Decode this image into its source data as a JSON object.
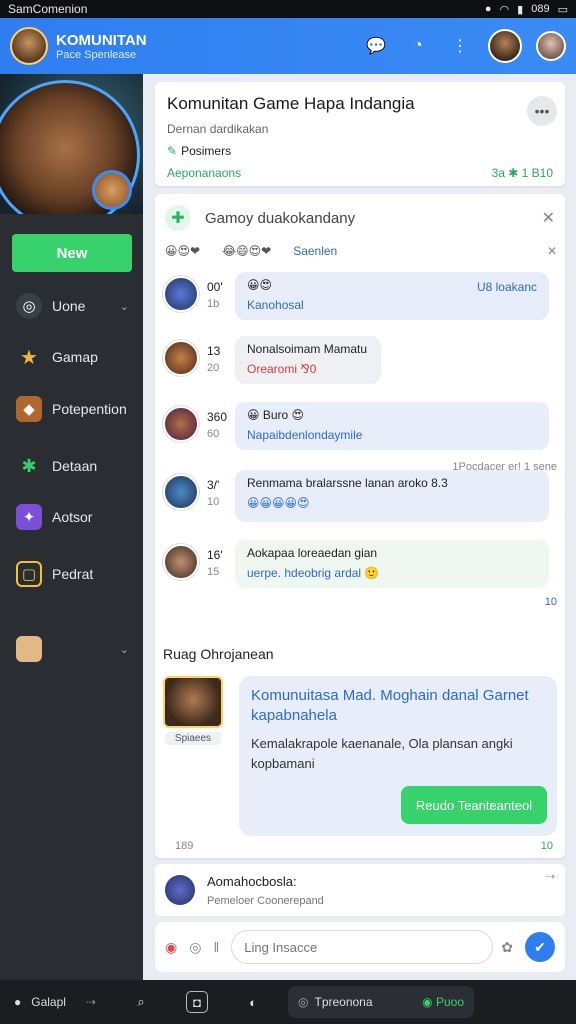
{
  "status": {
    "left": "SamComenion",
    "right": "089"
  },
  "header": {
    "title": "KOMUNITAN",
    "subtitle": "Pace Spenlease"
  },
  "sidebar": {
    "new_label": "New",
    "items": [
      {
        "label": "Uone",
        "icon": "target-icon"
      },
      {
        "label": "Gamap",
        "icon": "star-icon"
      },
      {
        "label": "Potepention",
        "icon": "game-icon"
      },
      {
        "label": "Detaan",
        "icon": "asterisk-icon"
      },
      {
        "label": "Aotsor",
        "icon": "purple-grid-icon"
      },
      {
        "label": "Pedrat",
        "icon": "square-icon"
      }
    ]
  },
  "post": {
    "title": "Komunitan Game Hapa Indangia",
    "subtitle": "Dernan dardikakan",
    "tag": "Posimers",
    "left_label": "Aeponanaons",
    "right_label": "3a  ✱ 1 B10"
  },
  "chat": {
    "search_placeholder": "Gamoy duakokandany",
    "reactions": [
      "😀😍❤",
      "😂😄😍❤",
      "Saenlen"
    ],
    "messages": [
      {
        "n1": "00'",
        "n2": "1b",
        "b1": "😀😍",
        "b2": "Kanohosal",
        "side": "U8 loakanc"
      },
      {
        "n1": "13",
        "n2": "20",
        "b1": "Nonalsoimam Mamatu",
        "b2": "Orearomi  ⅋0"
      },
      {
        "n1": "360",
        "n2": "60",
        "b1": "😀 Buro 😍",
        "b2": "Napaibdenlondaymile"
      },
      {
        "n1": "3/'",
        "n2": "10",
        "b1": "Renmama bralarssne lanan aroko 8.3",
        "b2": "😀😀😀😀😍"
      },
      {
        "n1": "16'",
        "n2": "15",
        "b1": "Aokapaa loreaedan gian",
        "b2": "uerpe. hdeobrig ardal 🙂"
      }
    ],
    "meta1": "1Pocdacer er! 1 sene",
    "meta2": "10",
    "section_title": "Ruag Ohrojanean",
    "feature": {
      "avatar_label": "Spiaees",
      "title": "Komunuitasa Mad. Moghain danal Garnet kapabnahela",
      "body": "Kemalakrapole kaenanale, Ola plansan angki kopbamani",
      "cta": "Reudo  Teanteanteol",
      "left": "189",
      "right": "10"
    }
  },
  "feed_item": {
    "title": "Aomahocbosla:",
    "subtitle": "Pemeloer  Coonerepand"
  },
  "composer": {
    "placeholder": "Ling Insacce"
  },
  "bottom": {
    "left": "Galapl",
    "pill_label": "Tpreonona",
    "pill_status": "Puoo"
  }
}
